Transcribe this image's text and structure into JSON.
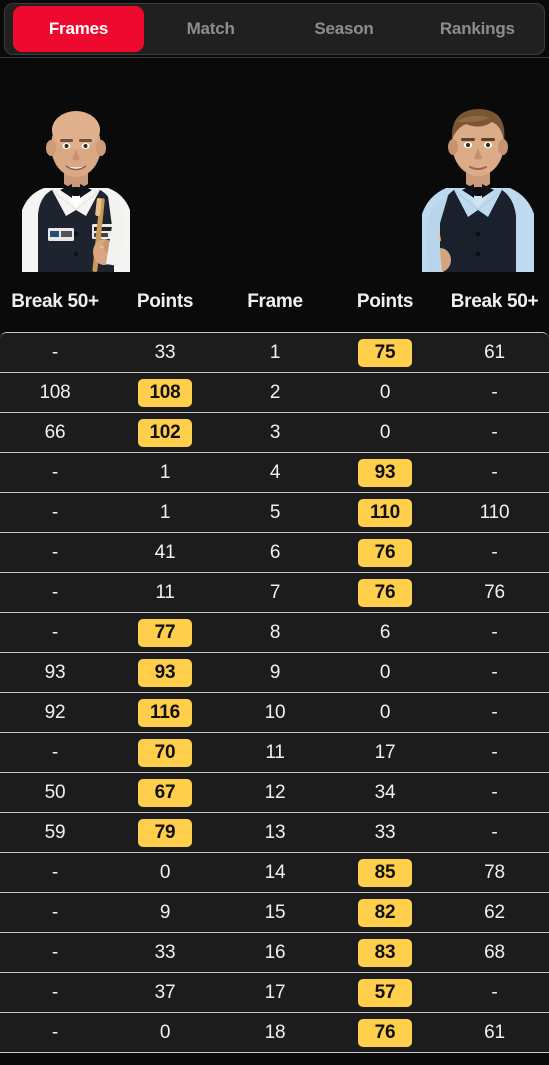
{
  "theme": {
    "background": "#0a0a0a",
    "row_background": "#1c1c1c",
    "accent_red": "#ee0a2e",
    "badge_yellow": "#ffce4a",
    "text_primary": "#f2f0ec",
    "text_muted": "#8d8d8d",
    "divider": "#c9c9c9"
  },
  "tabs": [
    {
      "label": "Frames",
      "active": true
    },
    {
      "label": "Match",
      "active": false
    },
    {
      "label": "Season",
      "active": false
    },
    {
      "label": "Rankings",
      "active": false
    }
  ],
  "players": {
    "left": {
      "icon": "player-portrait-left",
      "description": "bald snooker player in white shirt, black bow tie and dark waistcoat holding a cue"
    },
    "right": {
      "icon": "player-portrait-right",
      "description": "snooker player with light brown hair, light blue shirt, black bow tie and dark waistcoat holding a cue"
    }
  },
  "table": {
    "headers": [
      "Break 50+",
      "Points",
      "Frame",
      "Points",
      "Break 50+"
    ],
    "rows": [
      {
        "left_break": "-",
        "left_points": "33",
        "left_won": false,
        "frame": "1",
        "right_points": "75",
        "right_won": true,
        "right_break": "61"
      },
      {
        "left_break": "108",
        "left_points": "108",
        "left_won": true,
        "frame": "2",
        "right_points": "0",
        "right_won": false,
        "right_break": "-"
      },
      {
        "left_break": "66",
        "left_points": "102",
        "left_won": true,
        "frame": "3",
        "right_points": "0",
        "right_won": false,
        "right_break": "-"
      },
      {
        "left_break": "-",
        "left_points": "1",
        "left_won": false,
        "frame": "4",
        "right_points": "93",
        "right_won": true,
        "right_break": "-"
      },
      {
        "left_break": "-",
        "left_points": "1",
        "left_won": false,
        "frame": "5",
        "right_points": "110",
        "right_won": true,
        "right_break": "110"
      },
      {
        "left_break": "-",
        "left_points": "41",
        "left_won": false,
        "frame": "6",
        "right_points": "76",
        "right_won": true,
        "right_break": "-"
      },
      {
        "left_break": "-",
        "left_points": "11",
        "left_won": false,
        "frame": "7",
        "right_points": "76",
        "right_won": true,
        "right_break": "76"
      },
      {
        "left_break": "-",
        "left_points": "77",
        "left_won": true,
        "frame": "8",
        "right_points": "6",
        "right_won": false,
        "right_break": "-"
      },
      {
        "left_break": "93",
        "left_points": "93",
        "left_won": true,
        "frame": "9",
        "right_points": "0",
        "right_won": false,
        "right_break": "-"
      },
      {
        "left_break": "92",
        "left_points": "116",
        "left_won": true,
        "frame": "10",
        "right_points": "0",
        "right_won": false,
        "right_break": "-"
      },
      {
        "left_break": "-",
        "left_points": "70",
        "left_won": true,
        "frame": "11",
        "right_points": "17",
        "right_won": false,
        "right_break": "-"
      },
      {
        "left_break": "50",
        "left_points": "67",
        "left_won": true,
        "frame": "12",
        "right_points": "34",
        "right_won": false,
        "right_break": "-"
      },
      {
        "left_break": "59",
        "left_points": "79",
        "left_won": true,
        "frame": "13",
        "right_points": "33",
        "right_won": false,
        "right_break": "-"
      },
      {
        "left_break": "-",
        "left_points": "0",
        "left_won": false,
        "frame": "14",
        "right_points": "85",
        "right_won": true,
        "right_break": "78"
      },
      {
        "left_break": "-",
        "left_points": "9",
        "left_won": false,
        "frame": "15",
        "right_points": "82",
        "right_won": true,
        "right_break": "62"
      },
      {
        "left_break": "-",
        "left_points": "33",
        "left_won": false,
        "frame": "16",
        "right_points": "83",
        "right_won": true,
        "right_break": "68"
      },
      {
        "left_break": "-",
        "left_points": "37",
        "left_won": false,
        "frame": "17",
        "right_points": "57",
        "right_won": true,
        "right_break": "-"
      },
      {
        "left_break": "-",
        "left_points": "0",
        "left_won": false,
        "frame": "18",
        "right_points": "76",
        "right_won": true,
        "right_break": "61"
      }
    ]
  }
}
